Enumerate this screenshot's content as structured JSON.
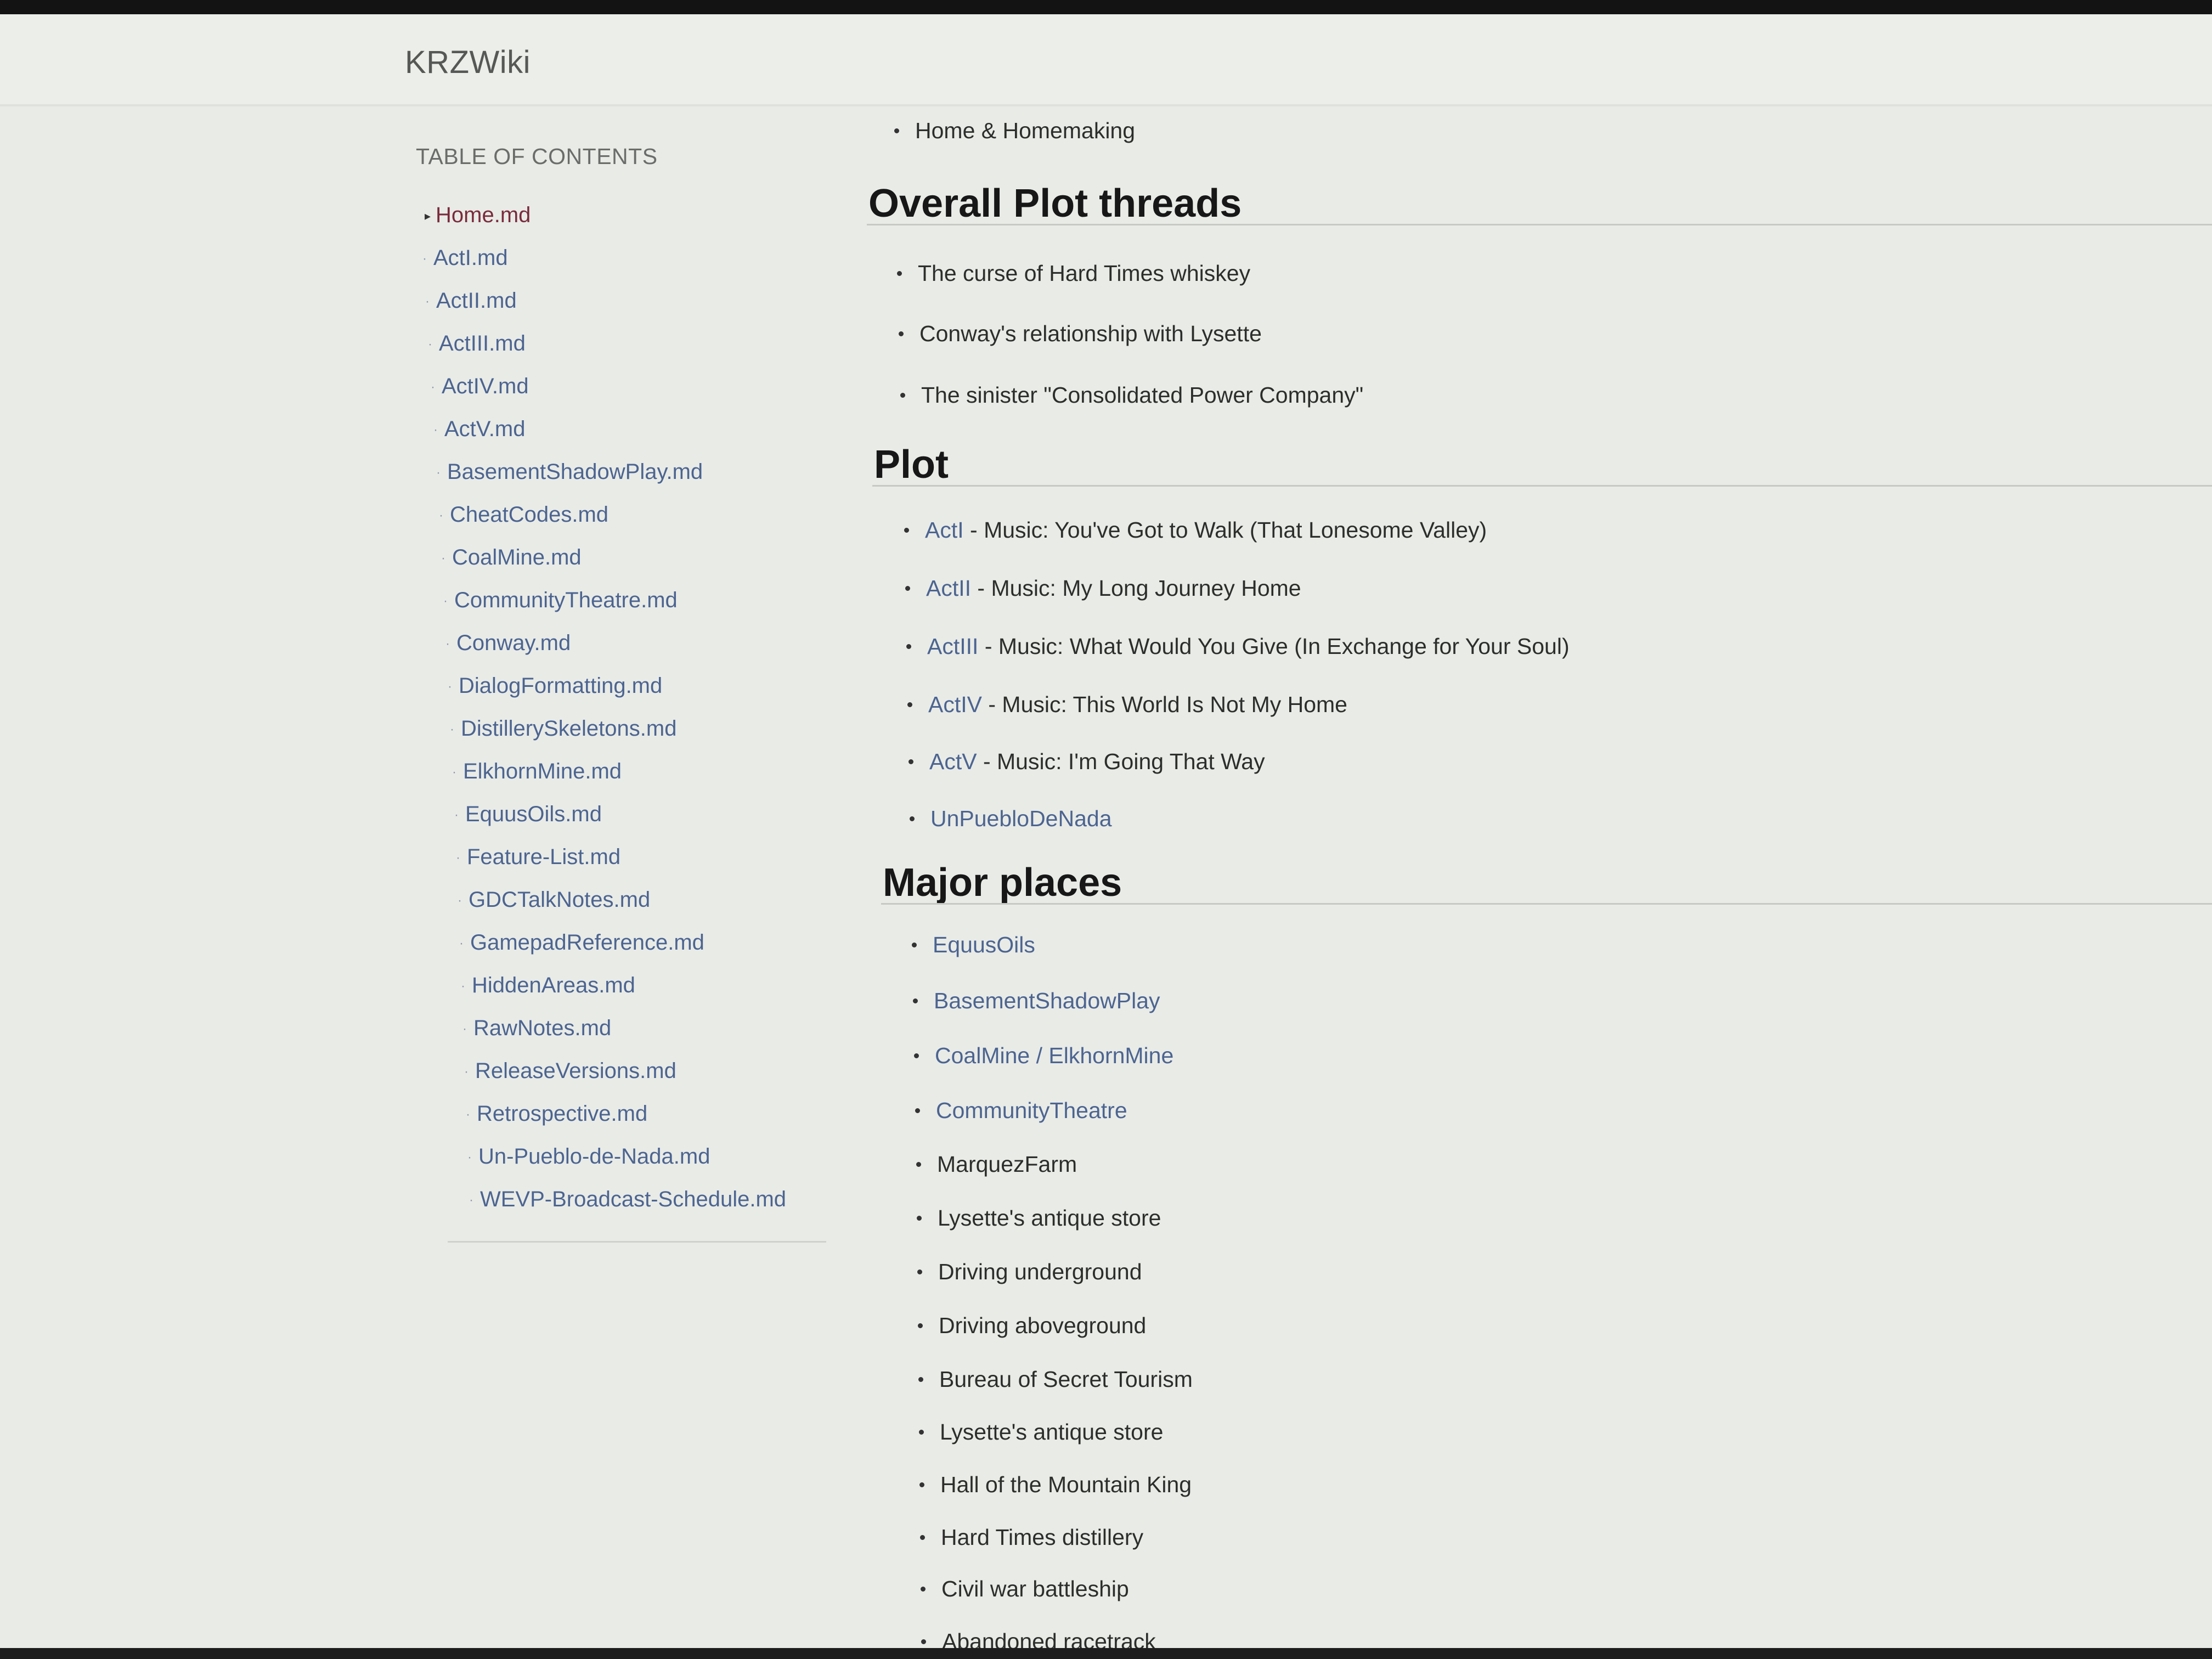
{
  "header": {
    "brand": "KRZWiki"
  },
  "toc": {
    "title": "TABLE OF CONTENTS",
    "items": [
      "Home.md",
      "ActI.md",
      "ActII.md",
      "ActIII.md",
      "ActIV.md",
      "ActV.md",
      "BasementShadowPlay.md",
      "CheatCodes.md",
      "CoalMine.md",
      "CommunityTheatre.md",
      "Conway.md",
      "DialogFormatting.md",
      "DistillerySkeletons.md",
      "ElkhornMine.md",
      "EquusOils.md",
      "Feature-List.md",
      "GDCTalkNotes.md",
      "GamepadReference.md",
      "HiddenAreas.md",
      "RawNotes.md",
      "ReleaseVersions.md",
      "Retrospective.md",
      "Un-Pueblo-de-Nada.md",
      "WEVP-Broadcast-Schedule.md"
    ]
  },
  "main": {
    "top_item": "Home & Homemaking",
    "threads": {
      "heading": "Overall Plot threads",
      "items": [
        "The curse of Hard Times whiskey",
        "Conway's relationship with Lysette",
        "The sinister \"Consolidated Power Company\""
      ]
    },
    "plot": {
      "heading": "Plot",
      "items": [
        {
          "link": "ActI",
          "text": " - Music: You've Got to Walk (That Lonesome Valley)"
        },
        {
          "link": "ActII",
          "text": " - Music: My Long Journey Home"
        },
        {
          "link": "ActIII",
          "text": " - Music: What Would You Give (In Exchange for Your Soul)"
        },
        {
          "link": "ActIV",
          "text": " - Music: This World Is Not My Home"
        },
        {
          "link": "ActV",
          "text": " - Music: I'm Going That Way"
        },
        {
          "link": "UnPuebloDeNada",
          "text": ""
        }
      ]
    },
    "places": {
      "heading": "Major places",
      "links": {
        "equus": "EquusOils",
        "basement": "BasementShadowPlay",
        "coal": "CoalMine",
        "sep": " / ",
        "elkhorn": "ElkhornMine",
        "community": "CommunityTheatre"
      },
      "plain": [
        "MarquezFarm",
        "Lysette's antique store",
        "Driving underground",
        "Driving aboveground",
        "Bureau of Secret Tourism",
        "Lysette's antique store",
        "Hall of the Mountain King",
        "Hard Times distillery",
        "Civil war battleship",
        "Abandoned racetrack"
      ]
    }
  }
}
